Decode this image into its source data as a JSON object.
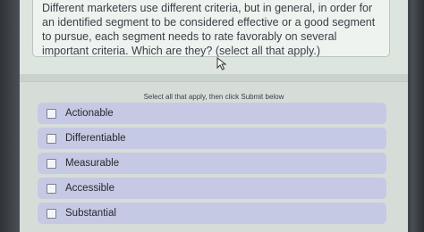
{
  "question": {
    "text": "Different marketers use different criteria, but in general, in order for an identified segment to be considered effective or a good segment to pursue, each segment needs to rate favorably on several important criteria. Which are they? (select all that apply.)"
  },
  "answers": {
    "instruction": "Select all that apply, then click Submit below",
    "options": [
      {
        "label": "Actionable",
        "checked": false
      },
      {
        "label": "Differentiable",
        "checked": false
      },
      {
        "label": "Measurable",
        "checked": false
      },
      {
        "label": "Accessible",
        "checked": false
      },
      {
        "label": "Substantial",
        "checked": false
      }
    ]
  },
  "colors": {
    "option_background": "#c6c9e3",
    "panel_background": "#dde5df"
  }
}
